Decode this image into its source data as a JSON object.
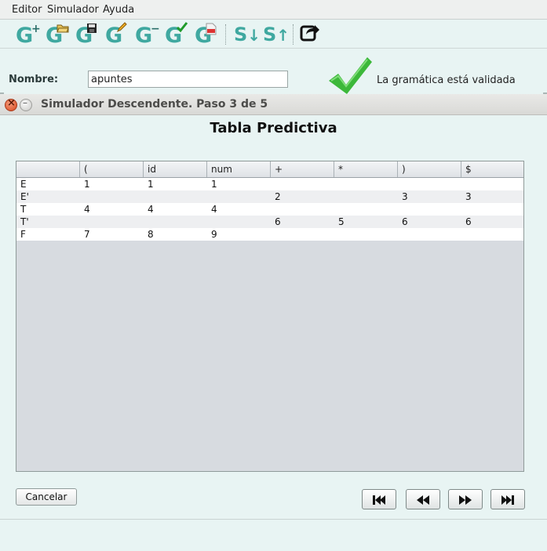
{
  "menubar": {
    "items": [
      {
        "label": "Editor"
      },
      {
        "label": "Simulador"
      },
      {
        "label": "Ayuda"
      }
    ]
  },
  "toolbar": {
    "buttons": [
      {
        "icon": "new-grammar-icon",
        "glyph": "G",
        "mark": "+"
      },
      {
        "icon": "open-grammar-icon",
        "glyph": "G"
      },
      {
        "icon": "save-grammar-icon",
        "glyph": "G"
      },
      {
        "icon": "edit-grammar-icon",
        "glyph": "G"
      },
      {
        "icon": "delete-grammar-icon",
        "glyph": "G",
        "mark": "−"
      },
      {
        "icon": "validate-grammar-icon",
        "glyph": "G"
      },
      {
        "icon": "export-pdf-icon",
        "glyph": "G",
        "mark": "PDF"
      },
      {
        "icon": "simulate-descending-icon",
        "glyph": "S"
      },
      {
        "icon": "simulate-ascending-icon",
        "glyph": "S"
      },
      {
        "icon": "share-icon"
      }
    ]
  },
  "main": {
    "name_label": "Nombre:",
    "name_value": "apuntes",
    "status_text": "La gramática está validada"
  },
  "dialog": {
    "title": "Simulador Descendente. Paso 3 de 5",
    "heading": "Tabla Predictiva",
    "cancel_label": "Cancelar"
  },
  "table": {
    "headers": [
      "",
      "(",
      "id",
      "num",
      "+",
      "*",
      ")",
      "$"
    ],
    "rows": [
      [
        "E",
        "1",
        "1",
        "1",
        "",
        "",
        "",
        ""
      ],
      [
        "E'",
        "",
        "",
        "",
        "2",
        "",
        "3",
        "3"
      ],
      [
        "T",
        "4",
        "4",
        "4",
        "",
        "",
        "",
        ""
      ],
      [
        "T'",
        "",
        "",
        "",
        "6",
        "5",
        "6",
        "6"
      ],
      [
        "F",
        "7",
        "8",
        "9",
        "",
        "",
        "",
        ""
      ]
    ]
  },
  "colors": {
    "accent": "#3fa8a0",
    "check": "#3cb83a",
    "background": "#e8f4f3"
  }
}
